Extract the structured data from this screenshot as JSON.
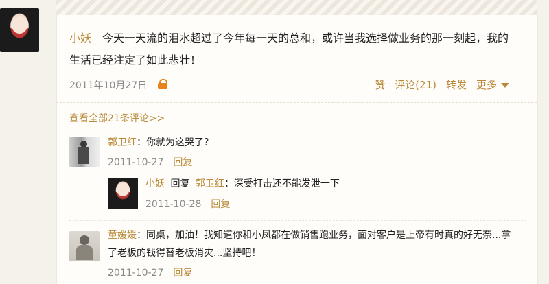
{
  "post": {
    "author": "小妖",
    "text": "今天一天流的泪水超过了今年每一天的总和，或许当我选择做业务的那一刻起，我的生活已经注定了如此悲壮！",
    "date": "2011年10月27日",
    "actions": {
      "like": "赞",
      "comment": "评论(21)",
      "forward": "转发",
      "more": "更多"
    }
  },
  "view_all": "查看全部21条评论>>",
  "comments": [
    {
      "name": "郭卫红",
      "text": "：你就为这哭了？",
      "date": "2011-10-27",
      "reply": "回复"
    },
    {
      "name": "小妖",
      "reply_word": "回复",
      "target": "郭卫红",
      "text": "：深受打击还不能发泄一下",
      "date": "2011-10-28",
      "reply": "回复"
    },
    {
      "name": "童媛媛",
      "text": "：同桌，加油！我知道你和小凤都在做销售跑业务，面对客户是上帝有时真的好无奈...拿了老板的钱得替老板消灾...坚持吧！",
      "date": "2011-10-27",
      "reply": "回复"
    }
  ]
}
